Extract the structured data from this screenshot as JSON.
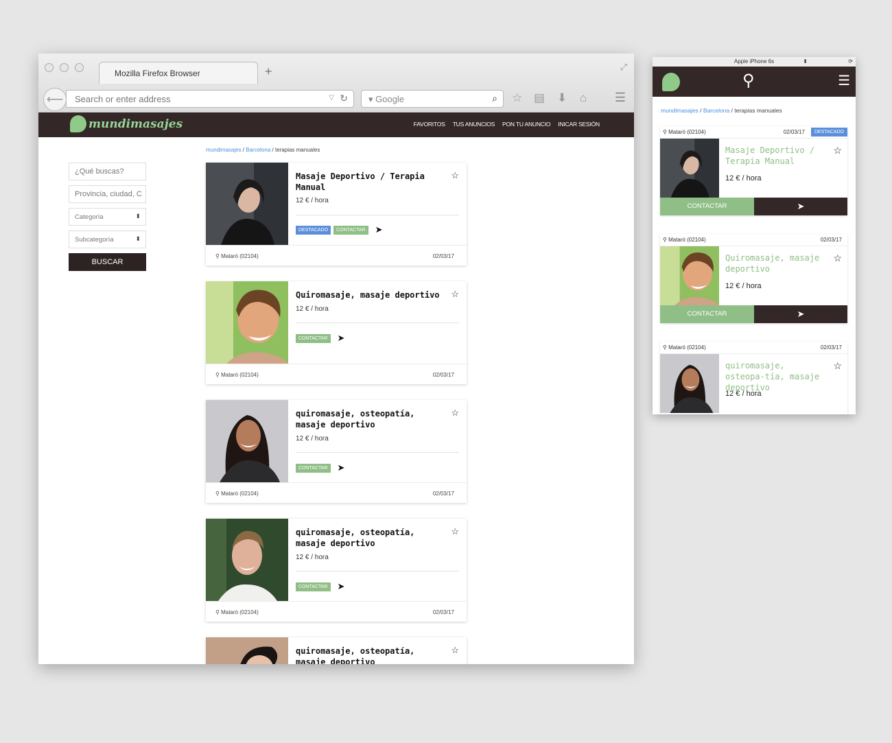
{
  "browser": {
    "tab_title": "Mozilla Firefox Browser",
    "new_tab": "+",
    "url_placeholder": "Search or enter address",
    "search_engine": "Google",
    "menu_icon": "hamburger-icon"
  },
  "site": {
    "logo_text": "mundimasajes",
    "nav": [
      "FAVORITOS",
      "TUS ANUNCIOS",
      "PON TU ANUNCIO",
      "INICAR SESIÓN"
    ],
    "colors": {
      "header": "#332727",
      "accent_green": "#8fbe86",
      "accent_blue": "#5b8fdc"
    }
  },
  "sidebar": {
    "search_placeholder": "¿Qué buscas?",
    "location_placeholder": "Provincia, ciudad, C",
    "category": "Categoría",
    "subcategory": "Subcategoría",
    "submit": "BUSCAR"
  },
  "breadcrumb": {
    "home": "mundimasajes",
    "city": "Barcelona",
    "current": "terapias manuales",
    "sep": " / "
  },
  "listings": [
    {
      "title": "Masaje Deportivo / Terapia Manual",
      "price": "12 € / hora",
      "featured_label": "DESTACADO",
      "contact_label": "CONTACTAR",
      "location": "Mataró (02104)",
      "date": "02/03/17"
    },
    {
      "title": "Quiromasaje, masaje deportivo",
      "price": "12 € / hora",
      "contact_label": "CONTACTAR",
      "location": "Mataró (02104)",
      "date": "02/03/17"
    },
    {
      "title": "quiromasaje, osteopatía, masaje deportivo",
      "price": "12 € / hora",
      "contact_label": "CONTACTAR",
      "location": "Mataró (02104)",
      "date": "02/03/17"
    },
    {
      "title": "quiromasaje, osteopatía, masaje deportivo",
      "price": "12 € / hora",
      "contact_label": "CONTACTAR",
      "location": "Mataró (02104)",
      "date": "02/03/17"
    },
    {
      "title": "quiromasaje, osteopatía, masaje deportivo"
    }
  ],
  "phone": {
    "device": "Apple iPhone 6s",
    "device_arrow": "⬍",
    "listings": [
      {
        "title": "Masaje Deportivo / Terapia Manual",
        "price": "12 € / hora",
        "location": "Mataró (02104)",
        "date": "02/03/17",
        "featured_label": "DESTACADO",
        "contact_label": "CONTACTAR"
      },
      {
        "title": "Quiromasaje, masaje deportivo",
        "price": "12 € / hora",
        "location": "Mataró (02104)",
        "date": "02/03/17",
        "contact_label": "CONTACTAR"
      },
      {
        "title": "quiromasaje, osteopa-tía, masaje deportivo",
        "price": "12 € / hora",
        "location": "Mataró (02104)",
        "date": "02/03/17"
      }
    ]
  }
}
